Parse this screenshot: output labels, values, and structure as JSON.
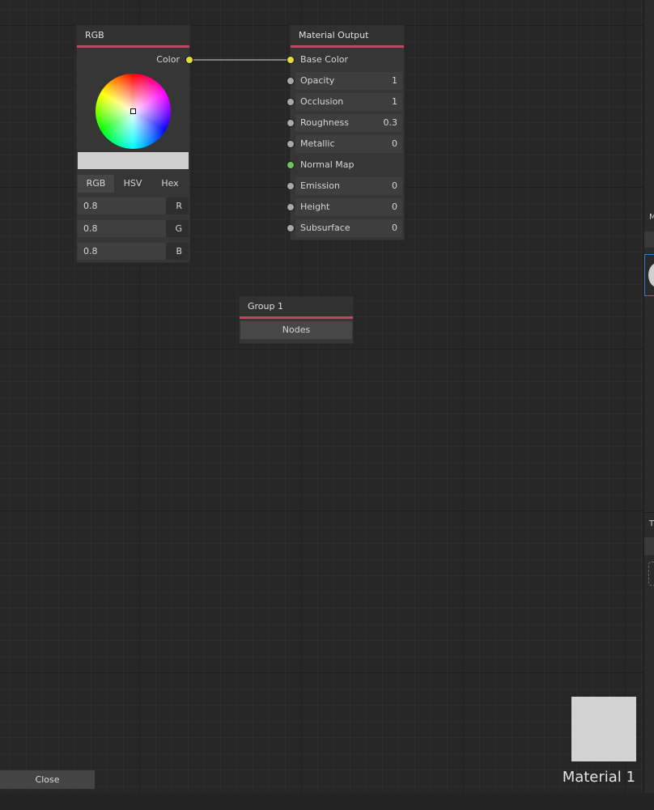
{
  "rgb_node": {
    "title": "RGB",
    "output_label": "Color",
    "modes": [
      "RGB",
      "HSV",
      "Hex"
    ],
    "active_mode": "RGB",
    "channels": [
      {
        "value": "0.8",
        "label": "R"
      },
      {
        "value": "0.8",
        "label": "G"
      },
      {
        "value": "0.8",
        "label": "B"
      }
    ],
    "swatch_color": "#d0d0d0"
  },
  "material_output": {
    "title": "Material Output",
    "inputs": [
      {
        "label": "Base Color",
        "value": "",
        "socket": "yellow"
      },
      {
        "label": "Opacity",
        "value": "1",
        "socket": "gray"
      },
      {
        "label": "Occlusion",
        "value": "1",
        "socket": "gray"
      },
      {
        "label": "Roughness",
        "value": "0.3",
        "socket": "gray"
      },
      {
        "label": "Metallic",
        "value": "0",
        "socket": "gray"
      },
      {
        "label": "Normal Map",
        "value": "",
        "socket": "green"
      },
      {
        "label": "Emission",
        "value": "0",
        "socket": "gray"
      },
      {
        "label": "Height",
        "value": "0",
        "socket": "gray"
      },
      {
        "label": "Subsurface",
        "value": "0",
        "socket": "gray"
      }
    ]
  },
  "group_node": {
    "title": "Group 1",
    "button_label": "Nodes"
  },
  "right_panel": {
    "tab_letter_1": "M",
    "tab_letter_2": "T"
  },
  "preview": {
    "material_name": "Material 1",
    "color": "#d3d3d3"
  },
  "footer": {
    "close_label": "Close"
  },
  "colors": {
    "accent": "#c0485c",
    "socket_yellow": "#e2dc3f",
    "socket_green": "#6ec45e",
    "socket_gray": "#a8a8a8"
  }
}
